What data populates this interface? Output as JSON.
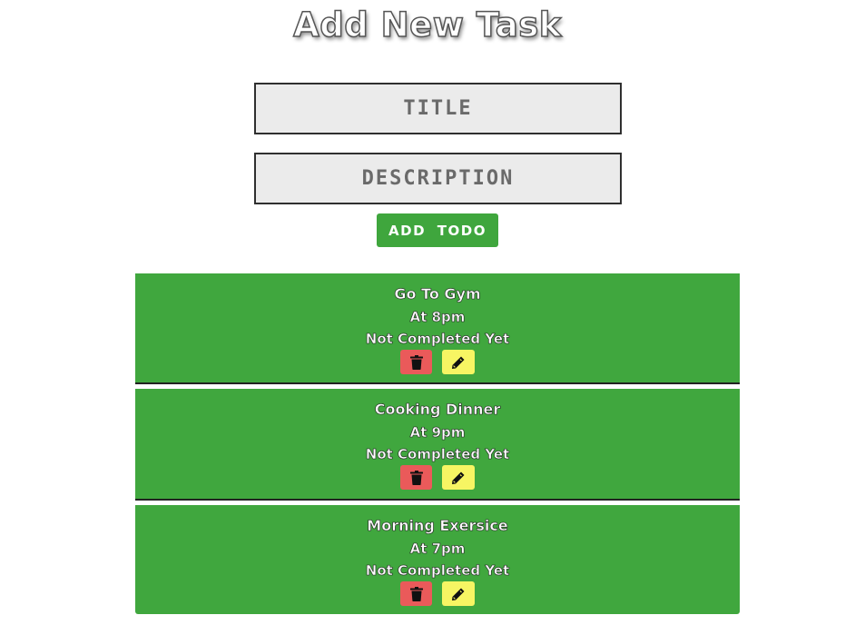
{
  "form": {
    "heading": "Add New Task",
    "title_placeholder": "TITLE",
    "description_placeholder": "DESCRIPTION",
    "add_button_label": "ADD TODO"
  },
  "todos": [
    {
      "title": "Go To Gym",
      "time": "At 8pm",
      "status": "Not Completed Yet"
    },
    {
      "title": "Cooking Dinner",
      "time": "At 9pm",
      "status": "Not Completed Yet"
    },
    {
      "title": "Morning Exersice",
      "time": "At 7pm",
      "status": "Not Completed Yet"
    }
  ],
  "icons": {
    "delete": "trash-icon",
    "edit": "pencil-icon"
  },
  "colors": {
    "todo_background": "#40a73e",
    "add_button": "#3fa63d",
    "delete_button": "#ea5a5a",
    "edit_button": "#f7f563",
    "input_background": "#ebebeb"
  }
}
